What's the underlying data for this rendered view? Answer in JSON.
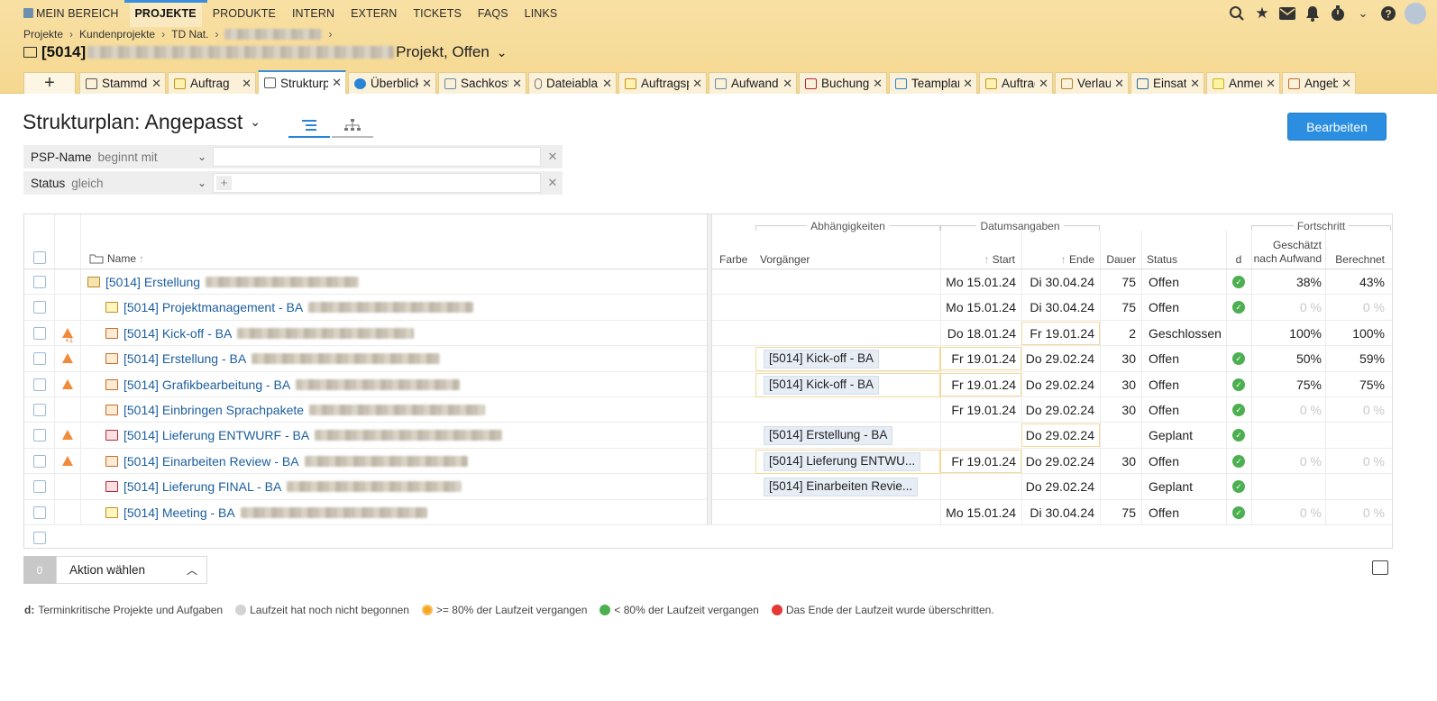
{
  "nav": {
    "items": [
      {
        "label": "MEIN BEREICH"
      },
      {
        "label": "PROJEKTE"
      },
      {
        "label": "PRODUKTE"
      },
      {
        "label": "INTERN"
      },
      {
        "label": "EXTERN"
      },
      {
        "label": "TICKETS"
      },
      {
        "label": "FAQS"
      },
      {
        "label": "LINKS"
      }
    ],
    "active": "PROJEKTE"
  },
  "breadcrumb": [
    "Projekte",
    "Kundenprojekte",
    "TD Nat."
  ],
  "project": {
    "code": "[5014]",
    "suffix": "Projekt, Offen"
  },
  "tabs": [
    {
      "label": "Stammd",
      "icon": "folder-icon"
    },
    {
      "label": "Auftrag",
      "icon": "order-icon"
    },
    {
      "label": "Strukturp",
      "icon": "structure-icon"
    },
    {
      "label": "Überblick",
      "icon": "info-icon"
    },
    {
      "label": "Sachkost",
      "icon": "costs-icon"
    },
    {
      "label": "Dateiabla",
      "icon": "attachment-icon"
    },
    {
      "label": "Auftragsp",
      "icon": "order-position-icon"
    },
    {
      "label": "Aufwand",
      "icon": "effort-icon"
    },
    {
      "label": "Buchung",
      "icon": "booking-icon"
    },
    {
      "label": "Teamplan",
      "icon": "team-icon"
    },
    {
      "label": "Auftrag",
      "icon": "order-icon"
    },
    {
      "label": "Verlauf",
      "icon": "history-icon"
    },
    {
      "label": "Einsatz",
      "icon": "deployment-icon"
    },
    {
      "label": "Anmer",
      "icon": "note-icon"
    },
    {
      "label": "Angeb",
      "icon": "offer-icon"
    }
  ],
  "page": {
    "title": "Strukturplan: Angepasst",
    "edit_label": "Bearbeiten"
  },
  "filters": [
    {
      "name": "PSP-Name",
      "op": "beginnt mit",
      "value": ""
    },
    {
      "name": "Status",
      "op": "gleich",
      "value": ""
    }
  ],
  "table": {
    "groups": {
      "deps": "Abhängigkeiten",
      "dates": "Datumsangaben",
      "progress": "Fortschritt"
    },
    "headers": {
      "name": "Name",
      "color": "Farbe",
      "pred": "Vorgänger",
      "start": "Start",
      "end": "Ende",
      "duration": "Dauer",
      "status": "Status",
      "d": "d",
      "estimated": "Geschätzt nach Aufwand",
      "calculated": "Berechnet"
    },
    "rows": [
      {
        "name": "[5014] Erstellung",
        "type": "folder",
        "indent": 0,
        "warn": false,
        "pred": "",
        "start": "Mo 15.01.24",
        "end": "Di 30.04.24",
        "duration": "75",
        "status": "Offen",
        "d": true,
        "est": "38%",
        "calc": "43%",
        "hl_start": false,
        "hl_end": false
      },
      {
        "name": "[5014] Projektmanagement - BA",
        "type": "meeting",
        "indent": 1,
        "warn": false,
        "pred": "",
        "start": "Mo 15.01.24",
        "end": "Di 30.04.24",
        "duration": "75",
        "status": "Offen",
        "d": true,
        "est": "0 %",
        "calc": "0 %",
        "muted": true,
        "hl_start": false,
        "hl_end": false
      },
      {
        "name": "[5014] Kick-off - BA",
        "type": "task",
        "indent": 1,
        "warn": true,
        "warn_plus": true,
        "pred": "",
        "start": "Do 18.01.24",
        "end": "Fr 19.01.24",
        "duration": "2",
        "status": "Geschlossen",
        "d": false,
        "est": "100%",
        "calc": "100%",
        "hl_start": false,
        "hl_end": true
      },
      {
        "name": "[5014] Erstellung - BA",
        "type": "task",
        "indent": 1,
        "warn": true,
        "pred": "[5014] Kick-off - BA",
        "start": "Fr 19.01.24",
        "end": "Do 29.02.24",
        "duration": "30",
        "status": "Offen",
        "d": true,
        "est": "50%",
        "calc": "59%",
        "hl_pred": true,
        "hl_start": true,
        "hl_end": false
      },
      {
        "name": "[5014] Grafikbearbeitung - BA",
        "type": "task",
        "indent": 1,
        "warn": true,
        "pred": "[5014] Kick-off - BA",
        "start": "Fr 19.01.24",
        "end": "Do 29.02.24",
        "duration": "30",
        "status": "Offen",
        "d": true,
        "est": "75%",
        "calc": "75%",
        "hl_pred": true,
        "hl_start": true,
        "hl_end": false
      },
      {
        "name": "[5014] Einbringen Sprachpakete",
        "type": "task",
        "indent": 1,
        "warn": false,
        "pred": "",
        "start": "Fr 19.01.24",
        "end": "Do 29.02.24",
        "duration": "30",
        "status": "Offen",
        "d": true,
        "est": "0 %",
        "calc": "0 %",
        "muted": true,
        "hl_start": false,
        "hl_end": false
      },
      {
        "name": "[5014] Lieferung ENTWURF - BA",
        "type": "milestone",
        "indent": 1,
        "warn": true,
        "pred": "[5014] Erstellung - BA",
        "start": "",
        "end": "Do 29.02.24",
        "duration": "",
        "status": "Geplant",
        "d": true,
        "est": "",
        "calc": "",
        "hl_start": false,
        "hl_end": true
      },
      {
        "name": "[5014] Einarbeiten Review - BA",
        "type": "task",
        "indent": 1,
        "warn": true,
        "pred": "[5014] Lieferung ENTWU...",
        "start": "Fr 19.01.24",
        "end": "Do 29.02.24",
        "duration": "30",
        "status": "Offen",
        "d": true,
        "est": "0 %",
        "calc": "0 %",
        "muted": true,
        "hl_pred": true,
        "hl_start": true,
        "hl_end": false
      },
      {
        "name": "[5014] Lieferung FINAL - BA",
        "type": "milestone",
        "indent": 1,
        "warn": false,
        "pred": "[5014] Einarbeiten Revie...",
        "start": "",
        "end": "Do 29.02.24",
        "duration": "",
        "status": "Geplant",
        "d": true,
        "est": "",
        "calc": "",
        "hl_start": false,
        "hl_end": false
      },
      {
        "name": "[5014] Meeting - BA",
        "type": "meeting",
        "indent": 1,
        "warn": false,
        "pred": "",
        "start": "Mo 15.01.24",
        "end": "Di 30.04.24",
        "duration": "75",
        "status": "Offen",
        "d": true,
        "est": "0 %",
        "calc": "0 %",
        "muted": true,
        "hl_start": false,
        "hl_end": false
      }
    ]
  },
  "actions": {
    "count": "0",
    "label": "Aktion wählen"
  },
  "legend": {
    "d": "d:",
    "d_text": "Terminkritische Projekte und Aufgaben",
    "grey": "Laufzeit hat noch nicht begonnen",
    "orange": ">= 80% der Laufzeit vergangen",
    "green": "< 80% der Laufzeit vergangen",
    "red": "Das Ende der Laufzeit wurde überschritten."
  }
}
